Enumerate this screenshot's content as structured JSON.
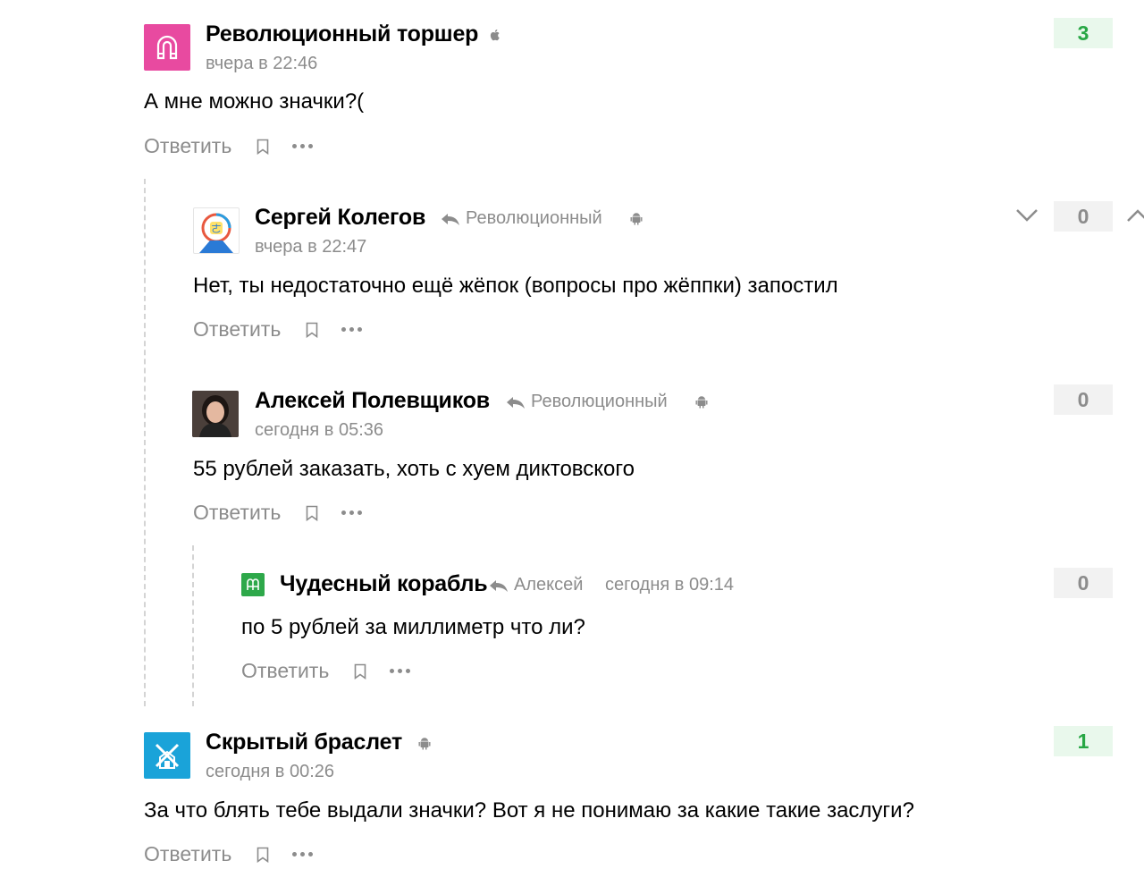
{
  "common": {
    "reply_label": "Ответить"
  },
  "comments": [
    {
      "author": "Революционный торшер",
      "time": "вчера в 22:46",
      "text": "А мне можно значки?(",
      "score": "3",
      "device_icon": "apple-icon",
      "avatar_color": "#e84aa0"
    },
    {
      "author": "Сергей Колегов",
      "reply_to": "Революционный",
      "time": "вчера в 22:47",
      "text": "Нет, ты недостаточно ещё жёпок (вопросы про жёппки) запостил",
      "score": "0",
      "device_icon": "android-icon"
    },
    {
      "author": "Алексей Полевщиков",
      "reply_to": "Революционный",
      "time": "сегодня в 05:36",
      "text": "55 рублей заказать, хоть с хуем диктовского",
      "score": "0",
      "device_icon": "android-icon"
    },
    {
      "author": "Чудесный корабль",
      "reply_to": "Алексей",
      "time": "сегодня в 09:14",
      "text": "по 5 рублей за миллиметр что ли?",
      "score": "0",
      "avatar_color": "#2ea84a"
    },
    {
      "author": "Скрытый браслет",
      "time": "сегодня в 00:26",
      "text": "За что блять тебе выдали значки? Вот я не понимаю за какие такие заслуги?",
      "score": "1",
      "device_icon": "android-icon",
      "avatar_color": "#1aa3d9"
    }
  ],
  "colors": {
    "positive": "#28a745",
    "positive_bg": "#e9f8ec",
    "muted": "#8c8c8c",
    "zero_bg": "#f2f2f2"
  }
}
